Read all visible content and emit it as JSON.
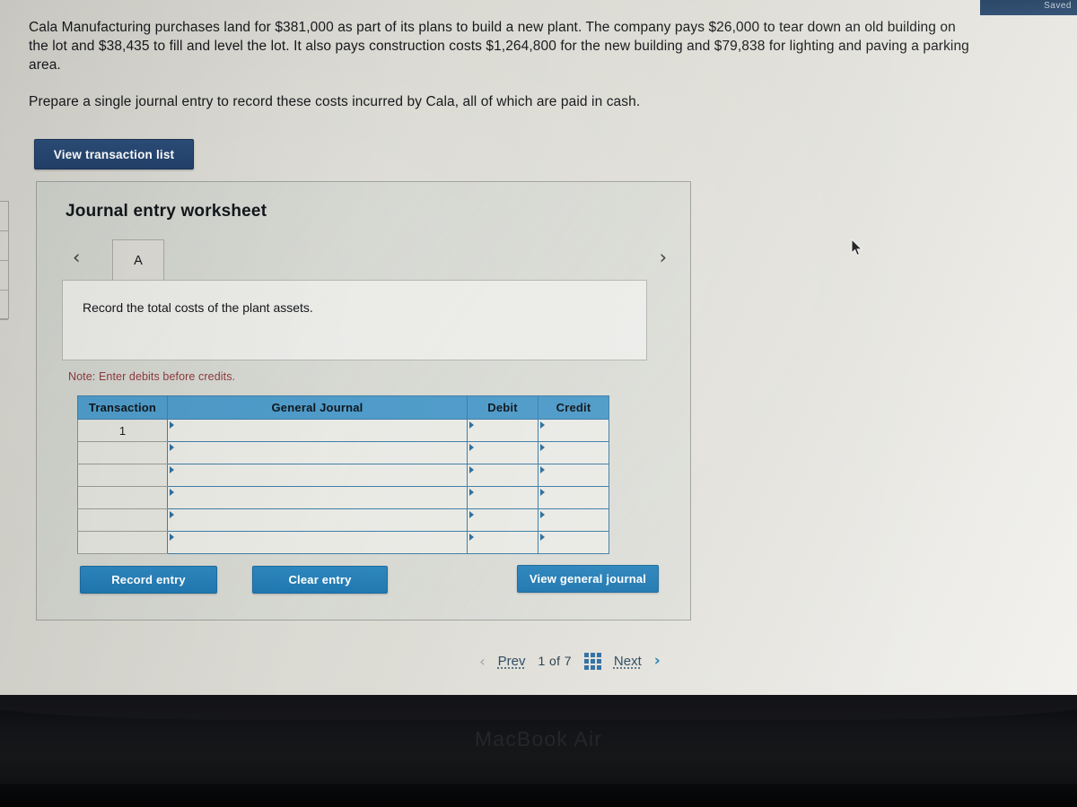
{
  "device": {
    "brand_label": "MacBook Air"
  },
  "topbar": {
    "fragment_text": "Saved"
  },
  "problem": {
    "paragraph1": "Cala Manufacturing purchases land for $381,000 as part of its plans to build a new plant. The company pays $26,000 to tear down an old building on the lot and $38,435 to fill and level the lot. It also pays  construction costs $1,264,800 for the new building and $79,838 for lighting and paving a parking area.",
    "paragraph2": "Prepare a single journal entry to record these costs incurred by Cala, all of which are paid in cash."
  },
  "buttons": {
    "view_transaction_list": "View transaction list",
    "record_entry": "Record entry",
    "clear_entry": "Clear entry",
    "view_general_journal": "View general journal"
  },
  "worksheet": {
    "title": "Journal entry worksheet",
    "tabs": [
      {
        "label": "A",
        "active": true
      }
    ],
    "prev_chevron": "‹",
    "next_chevron": "›",
    "instruction": "Record the total costs of the plant assets.",
    "note": "Note: Enter debits before credits.",
    "table": {
      "headers": [
        "Transaction",
        "General Journal",
        "Debit",
        "Credit"
      ],
      "rows": [
        {
          "transaction": "1",
          "general_journal": "",
          "debit": "",
          "credit": ""
        },
        {
          "transaction": "",
          "general_journal": "",
          "debit": "",
          "credit": ""
        },
        {
          "transaction": "",
          "general_journal": "",
          "debit": "",
          "credit": ""
        },
        {
          "transaction": "",
          "general_journal": "",
          "debit": "",
          "credit": ""
        },
        {
          "transaction": "",
          "general_journal": "",
          "debit": "",
          "credit": ""
        },
        {
          "transaction": "",
          "general_journal": "",
          "debit": "",
          "credit": ""
        }
      ]
    }
  },
  "pagination": {
    "prev_label": "Prev",
    "prev_chevron": "‹",
    "count_label": "1 of 7",
    "current_page": 1,
    "total_pages": 7,
    "grid_icon": "grid-icon",
    "next_label": "Next",
    "next_chevron": "›"
  },
  "colors": {
    "accent_blue": "#2078b0",
    "header_blue": "#4f9bc9",
    "navy_button": "#22406a",
    "note_red": "#8e3a3c"
  }
}
